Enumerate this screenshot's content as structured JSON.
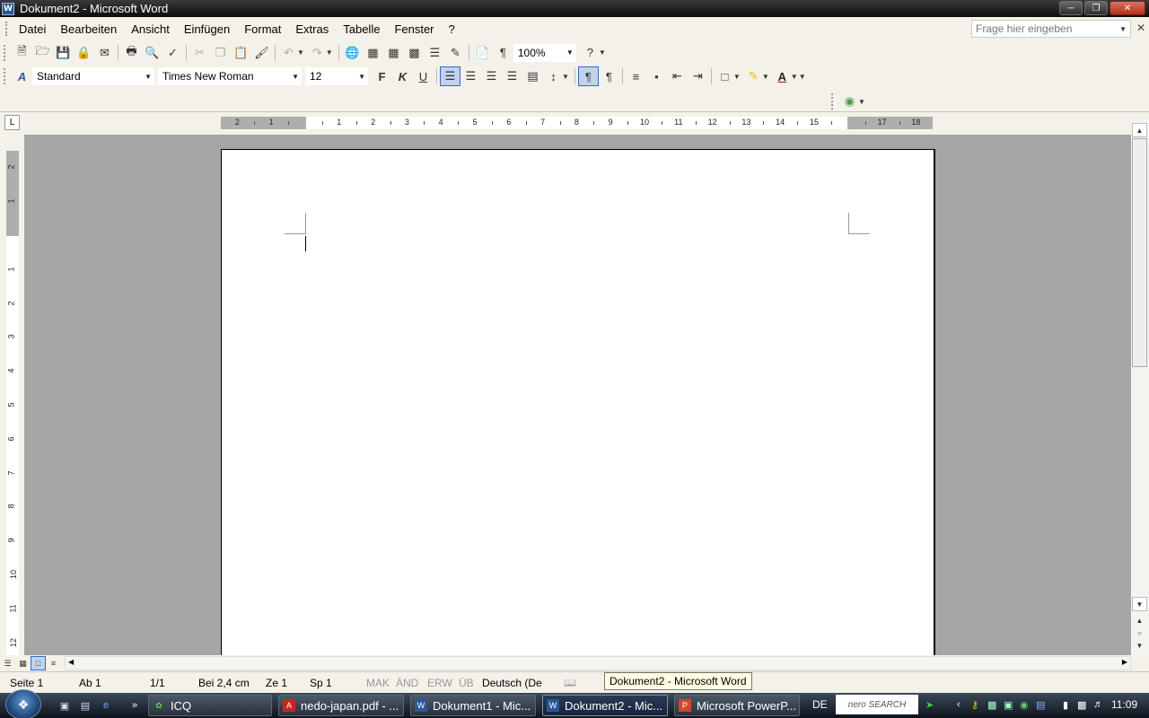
{
  "window": {
    "title": "Dokument2 - Microsoft Word",
    "app_icon": "W"
  },
  "menu": {
    "items": [
      "Datei",
      "Bearbeiten",
      "Ansicht",
      "Einfügen",
      "Format",
      "Extras",
      "Tabelle",
      "Fenster",
      "?"
    ],
    "help_placeholder": "Frage hier eingeben"
  },
  "standard_toolbar": {
    "zoom": "100%"
  },
  "format_toolbar": {
    "style": "Standard",
    "font": "Times New Roman",
    "size": "12",
    "bold_label": "F",
    "italic_label": "K",
    "underline_label": "U"
  },
  "ruler": {
    "h_numbers": [
      "2",
      "1",
      "1",
      "2",
      "3",
      "4",
      "5",
      "6",
      "7",
      "8",
      "9",
      "10",
      "11",
      "12",
      "13",
      "14",
      "15",
      "17",
      "18"
    ],
    "v_numbers": [
      "2",
      "1",
      "1",
      "2",
      "3",
      "4",
      "5",
      "6",
      "7",
      "8",
      "9",
      "10",
      "11",
      "12"
    ],
    "tab_selector": "L"
  },
  "status": {
    "page": "Seite 1",
    "section": "Ab 1",
    "pages": "1/1",
    "position": "Bei 2,4 cm",
    "line": "Ze 1",
    "column": "Sp 1",
    "mak": "MAK",
    "and": "ÄND",
    "erw": "ERW",
    "ub": "ÜB",
    "language": "Deutsch (De"
  },
  "tooltip": "Dokument2 - Microsoft Word",
  "taskbar": {
    "tasks": [
      "ICQ",
      "nedo-japan.pdf - ...",
      "Dokument1 - Mic...",
      "Dokument2 - Mic...",
      "Microsoft PowerP..."
    ],
    "language": "DE",
    "nero": "nero SEARCH",
    "clock": "11:09"
  }
}
